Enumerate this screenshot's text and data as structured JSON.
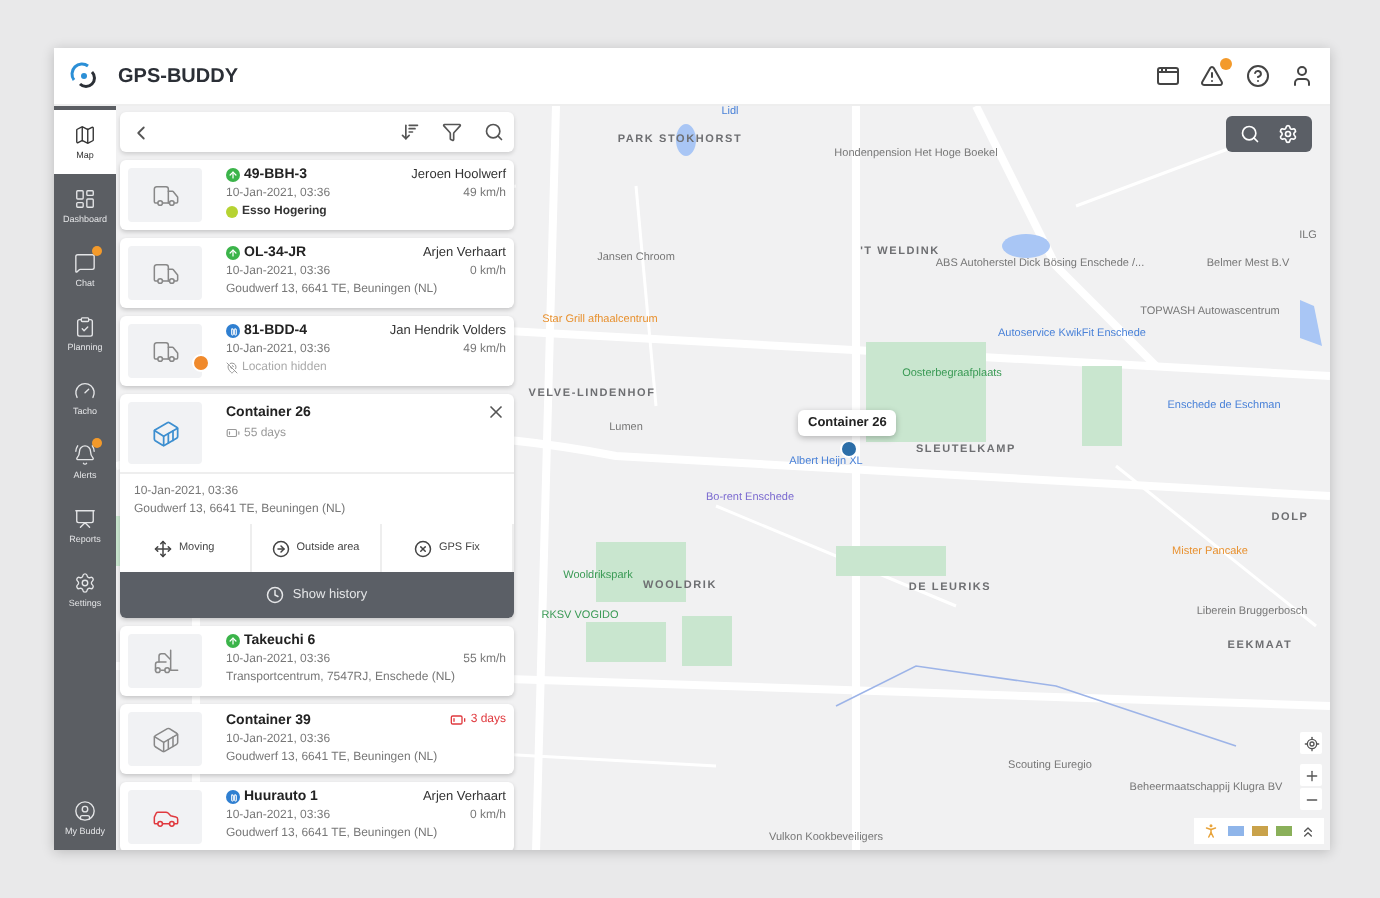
{
  "header": {
    "logo": "GPS-BUDDY",
    "alerts_badge": true
  },
  "sidebar": {
    "items": [
      {
        "label": "Map",
        "selected": true,
        "badge": false
      },
      {
        "label": "Dashboard",
        "selected": false,
        "badge": false
      },
      {
        "label": "Chat",
        "selected": false,
        "badge": true
      },
      {
        "label": "Planning",
        "selected": false,
        "badge": false
      },
      {
        "label": "Tacho",
        "selected": false,
        "badge": false
      },
      {
        "label": "Alerts",
        "selected": false,
        "badge": true
      },
      {
        "label": "Reports",
        "selected": false,
        "badge": false
      },
      {
        "label": "Settings",
        "selected": false,
        "badge": false
      }
    ],
    "footer": {
      "label": "My Buddy"
    }
  },
  "list": [
    {
      "kind": "vehicle",
      "moving": true,
      "name": "49-BBH-3",
      "driver": "Jeroen Hoolwerf",
      "time": "10-Jan-2021, 03:36",
      "speed": "49 km/h",
      "location": "Esso Hogering",
      "geofence": true,
      "location_hidden": false,
      "warning": false
    },
    {
      "kind": "vehicle",
      "moving": true,
      "name": "OL-34-JR",
      "driver": "Arjen Verhaart",
      "time": "10-Jan-2021, 03:36",
      "speed": "0 km/h",
      "location": "Goudwerf 13, 6641 TE, Beuningen (NL)",
      "geofence": false,
      "location_hidden": false,
      "warning": false
    },
    {
      "kind": "vehicle",
      "moving": false,
      "name": "81-BDD-4",
      "driver": "Jan Hendrik Volders",
      "time": "10-Jan-2021, 03:36",
      "speed": "49 km/h",
      "location": "Location hidden",
      "geofence": false,
      "location_hidden": true,
      "warning": true
    },
    {
      "kind": "expanded",
      "name": "Container 26",
      "battery": "55 days",
      "time": "10-Jan-2021, 03:36",
      "location": "Goudwerf 13, 6641 TE, Beuningen (NL)",
      "actions": [
        "Moving",
        "Outside area",
        "GPS Fix"
      ],
      "history": "Show history"
    },
    {
      "kind": "vehicle",
      "moving": true,
      "name": "Takeuchi 6",
      "time": "10-Jan-2021, 03:36",
      "speed": "55 km/h",
      "location": "Transportcentrum, 7547RJ, Enschede (NL)",
      "geofence": false,
      "location_hidden": false,
      "warning": false
    },
    {
      "kind": "container",
      "name": "Container 39",
      "battery": "3 days",
      "battery_low": true,
      "time": "10-Jan-2021, 03:36",
      "location": "Goudwerf 13, 6641 TE, Beuningen (NL)"
    },
    {
      "kind": "vehicle",
      "moving": false,
      "name": "Huurauto 1",
      "driver": "Arjen Verhaart",
      "time": "10-Jan-2021, 03:36",
      "speed": "0 km/h",
      "location": "Goudwerf 13, 6641 TE, Beuningen (NL)",
      "geofence": false,
      "location_hidden": false,
      "warning": false
    }
  ],
  "map": {
    "labels": [
      {
        "text": "Lidl",
        "kind": "shop"
      },
      {
        "text": "PARK STOKHORST",
        "kind": "district"
      },
      {
        "text": "Hondenpension Het Hoge Boekel",
        "kind": "poi"
      },
      {
        "text": "ILG",
        "kind": "poi"
      },
      {
        "text": "'T WELDINK",
        "kind": "district"
      },
      {
        "text": "Jansen Chroom",
        "kind": "poi"
      },
      {
        "text": "ABS Autoherstel Dick Bösing Enschede /...",
        "kind": "poi"
      },
      {
        "text": "Belmer Mest B.V",
        "kind": "poi"
      },
      {
        "text": "TOPWASH Autowascentrum",
        "kind": "poi"
      },
      {
        "text": "Star Grill afhaalcentrum",
        "kind": "food"
      },
      {
        "text": "Autoservice KwikFit Enschede",
        "kind": "shop"
      },
      {
        "text": "Oosterbegraafplaats",
        "kind": "park"
      },
      {
        "text": "VELVE-LINDENHOF",
        "kind": "district"
      },
      {
        "text": "Enschede de Eschman",
        "kind": "shop"
      },
      {
        "text": "Lumen",
        "kind": "poi"
      },
      {
        "text": "SLEUTELKAMP",
        "kind": "district"
      },
      {
        "text": "Albert Heijn XL",
        "kind": "shop"
      },
      {
        "text": "Bo-rent Enschede",
        "kind": "service"
      },
      {
        "text": "DOLP",
        "kind": "district"
      },
      {
        "text": "Mister Pancake",
        "kind": "food"
      },
      {
        "text": "Wooldrikspark",
        "kind": "park"
      },
      {
        "text": "WOOLDRIK",
        "kind": "district"
      },
      {
        "text": "DE LEURIKS",
        "kind": "district"
      },
      {
        "text": "RKSV VOGIDO",
        "kind": "park"
      },
      {
        "text": "Liberein Bruggerbosch",
        "kind": "poi"
      },
      {
        "text": "EEKMAAT",
        "kind": "district"
      },
      {
        "text": "Scouting Euregio",
        "kind": "poi"
      },
      {
        "text": "Beheermaatschappij Klugra BV",
        "kind": "poi"
      },
      {
        "text": "Vulkon Kookbeveiligers",
        "kind": "poi"
      }
    ],
    "marker": {
      "label": "Container 26"
    }
  }
}
